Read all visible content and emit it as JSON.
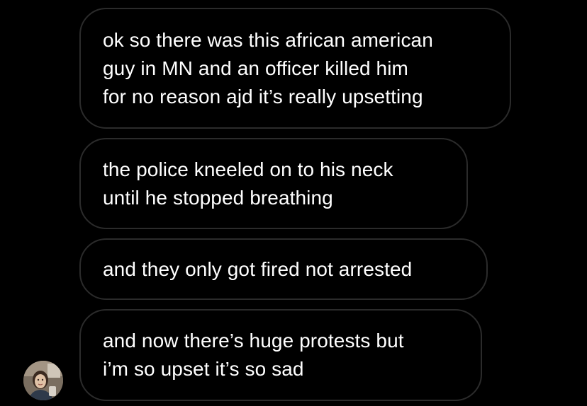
{
  "conversation": {
    "messages": [
      {
        "text": "ok so there was this african american\nguy in MN and an officer killed him\nfor no reason ajd it’s really upsetting"
      },
      {
        "text": "the police kneeled on to his neck\nuntil he stopped breathing"
      },
      {
        "text": "and they only got fired not arrested"
      },
      {
        "text": "and now there’s huge protests but\ni’m so upset it’s so sad"
      }
    ],
    "sender_avatar": {
      "icon": "profile-photo"
    },
    "colors": {
      "background": "#000000",
      "bubble_border": "#2b2b2b",
      "text": "#ffffff"
    }
  }
}
